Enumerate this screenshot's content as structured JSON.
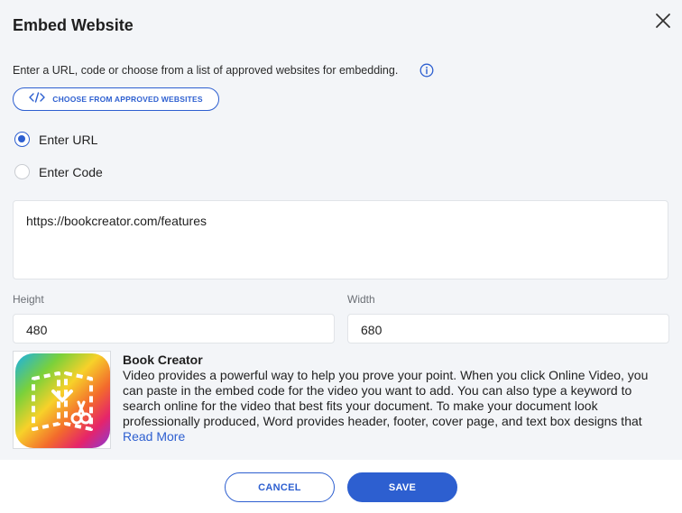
{
  "dialog": {
    "title": "Embed Website",
    "description": "Enter a URL, code or choose from a list of approved websites for embedding.",
    "approved_button": "CHOOSE FROM APPROVED WEBSITES"
  },
  "radios": [
    {
      "label": "Enter URL",
      "checked": true
    },
    {
      "label": "Enter Code",
      "checked": false
    }
  ],
  "url_value": "https://bookcreator.com/features",
  "dimensions": {
    "height_label": "Height",
    "height_value": "480",
    "width_label": "Width",
    "width_value": "680"
  },
  "website_card": {
    "name": "Book Creator",
    "description": "Video provides a powerful way to help you prove your point. When you click Online Video, you can paste in the embed code for the video you want to add. You can also type a keyword to search online for the video that best fits your document. To make your document look professionally produced, Word provides header, footer, cover page, and text box designs that complement each other.",
    "read_more": "Read More"
  },
  "footer": {
    "cancel": "CANCEL",
    "save": "SAVE"
  },
  "colors": {
    "accent": "#2d5fd0",
    "background": "#f3f5f8"
  },
  "icons": [
    "close-icon",
    "info-icon",
    "code-icon",
    "book-creator-logo"
  ]
}
